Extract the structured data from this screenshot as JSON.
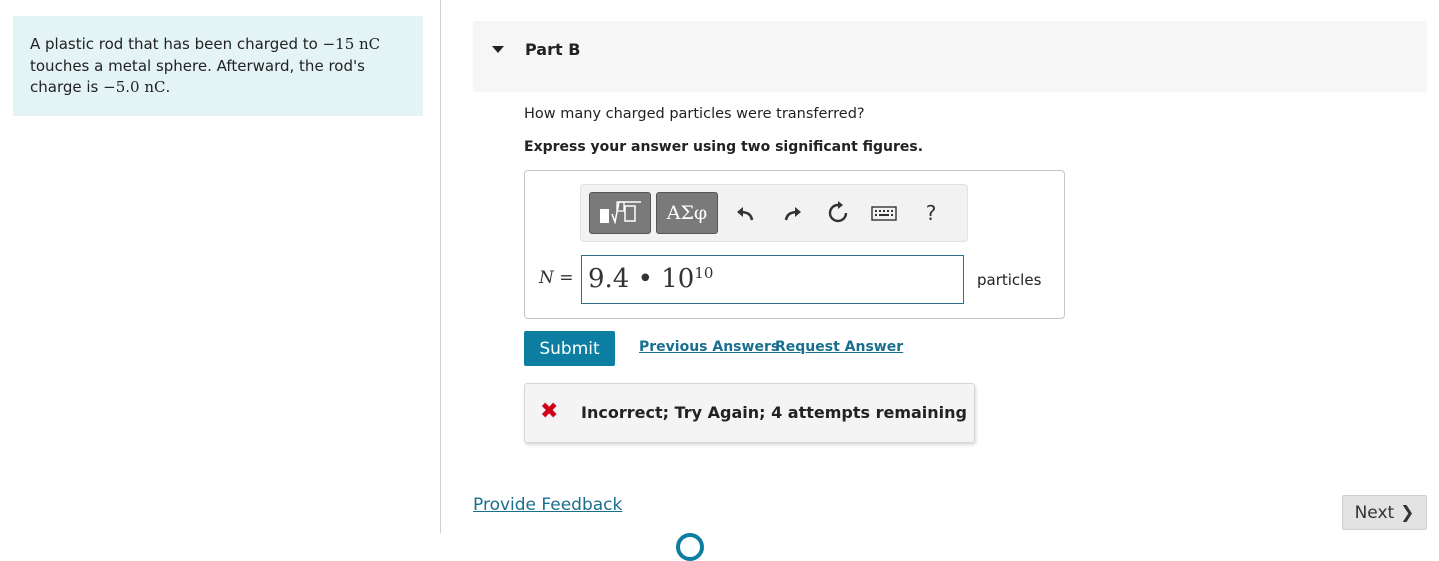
{
  "problem": {
    "text_before": "A plastic rod that has been charged to ",
    "charge_initial": "−15 nC",
    "text_middle": " touches a metal sphere. Afterward, the rod's charge is ",
    "charge_final": "−5.0 nC",
    "text_end": "."
  },
  "part": {
    "title": "Part B"
  },
  "question": {
    "prompt": "How many charged particles were transferred?",
    "instruction": "Express your answer using two significant figures."
  },
  "toolbar": {
    "greek_label": "ΑΣφ",
    "help_label": "?"
  },
  "answer": {
    "variable": "N",
    "equals": " =",
    "mantissa": "9.4 • 10",
    "exponent": "10",
    "units": "particles"
  },
  "actions": {
    "submit": "Submit",
    "previous_answers": "Previous Answers",
    "request_answer": "Request Answer"
  },
  "feedback": {
    "icon": "✖",
    "message": "Incorrect; Try Again; 4 attempts remaining"
  },
  "footer": {
    "provide_feedback": "Provide Feedback",
    "next": "Next",
    "next_chevron": "❯"
  },
  "colors": {
    "accent": "#0b7ea1",
    "error": "#d0021b",
    "problem_bg": "#e4f4f6"
  }
}
